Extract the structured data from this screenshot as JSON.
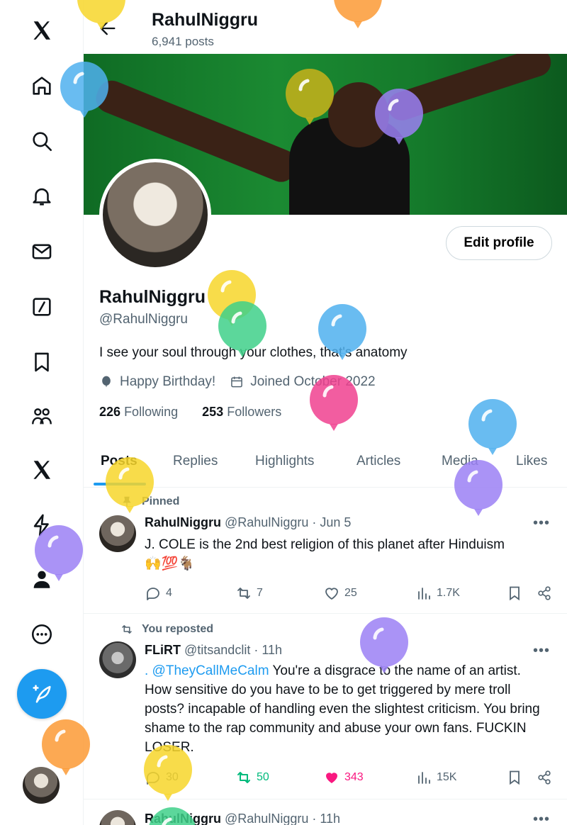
{
  "profile": {
    "name": "RahulNiggru",
    "posts_count": "6,941 posts",
    "handle": "@RahulNiggru",
    "bio": "I see your soul through your clothes, that's anatomy",
    "birthday": "Happy Birthday!",
    "joined": "Joined October 2022",
    "following_count": "226",
    "following_label": "Following",
    "followers_count": "253",
    "followers_label": "Followers",
    "edit_label": "Edit profile"
  },
  "tabs": [
    "Posts",
    "Replies",
    "Highlights",
    "Articles",
    "Media",
    "Likes"
  ],
  "posts": [
    {
      "context": "Pinned",
      "name": "RahulNiggru",
      "handle": "@RahulNiggru",
      "time": "· Jun 5",
      "text": "J. COLE is the 2nd best religion of this planet after Hinduism",
      "emoji": "🙌💯🐐",
      "replies": "4",
      "reposts": "7",
      "likes": "25",
      "views": "1.7K"
    },
    {
      "context": "You reposted",
      "name": "FLiRT",
      "handle": "@titsandclit",
      "time": "· 11h",
      "mention": ". @TheyCallMeCalm",
      "text": " You're a disgrace to the name of an artist. How sensitive do you have to be to get triggered by mere troll posts? incapable of handling even the slightest criticism. You bring shame to the rap community and abuse your own fans. FUCKIN LOSER.",
      "replies": "30",
      "reposts": "50",
      "likes": "343",
      "views": "15K"
    },
    {
      "name": "RahulNiggru",
      "handle": "@RahulNiggru",
      "time": "· 11h"
    }
  ],
  "colors": {
    "accent": "#1d9bf0",
    "repost_active": "#00ba7c",
    "like_active": "#f91880",
    "balloon_yellow": "#f7d62a",
    "balloon_blue": "#4fb0ef",
    "balloon_purple": "#9b80f5",
    "balloon_pink": "#f0418f",
    "balloon_green": "#3fd089",
    "balloon_orange": "#fb9a35",
    "balloon_olive": "#c9b21a"
  },
  "icons": [
    "x-logo-icon",
    "home-icon",
    "search-icon",
    "bell-icon",
    "mail-icon",
    "slash-icon",
    "bookmark-icon",
    "communities-icon",
    "x-premium-icon",
    "lightning-icon",
    "profile-icon",
    "more-icon",
    "compose-icon"
  ]
}
